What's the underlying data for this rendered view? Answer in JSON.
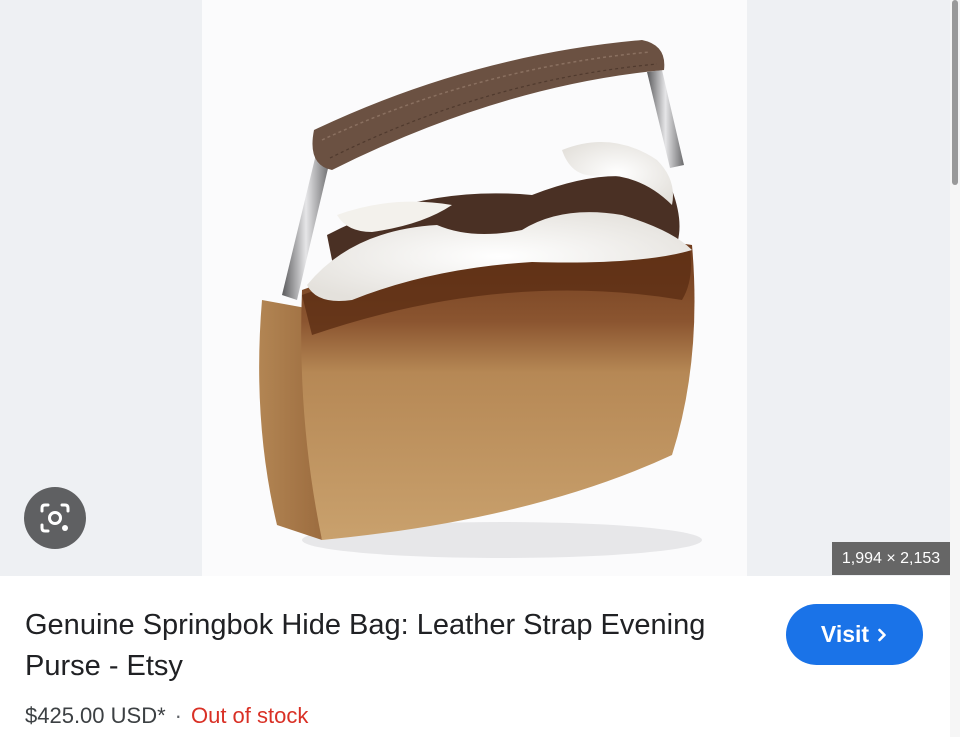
{
  "image": {
    "dimensions": "1,994 × 2,153",
    "lens_icon": "google-lens-icon",
    "subject": "springbok hide handbag"
  },
  "result": {
    "title": "Genuine Springbok Hide Bag: Leather Strap Evening Purse - Etsy",
    "price": "$425.00 USD*",
    "separator": "·",
    "stock_status": "Out of stock",
    "visit_label": "Visit",
    "visit_icon": "chevron-right-icon"
  },
  "colors": {
    "accent": "#1a73e8",
    "out_of_stock": "#d93025"
  }
}
